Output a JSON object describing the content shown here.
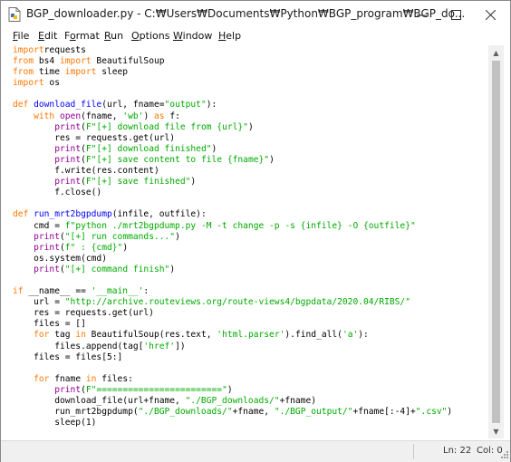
{
  "window": {
    "title": "BGP_downloader.py - C:₩Users₩Documents₩Python₩BGP_program₩BGP_do...",
    "app_icon": "python-file-icon",
    "minimize_icon": "minimize-icon",
    "maximize_icon": "maximize-icon",
    "close_icon": "close-icon"
  },
  "menu": [
    {
      "accel": "F",
      "rest": "ile"
    },
    {
      "accel": "E",
      "rest": "dit"
    },
    {
      "accel": "",
      "pre": "F",
      "accel2": "o",
      "rest": "rmat"
    },
    {
      "accel": "R",
      "rest": "un"
    },
    {
      "accel": "O",
      "rest": "ptions"
    },
    {
      "accel": "W",
      "rest": "indow"
    },
    {
      "accel": "H",
      "rest": "elp"
    }
  ],
  "menu_labels": [
    "File",
    "Edit",
    "Format",
    "Run",
    "Options",
    "Window",
    "Help"
  ],
  "editor": {
    "lines": [
      [
        [
          "kw",
          "import"
        ],
        [
          "",
          "requests"
        ]
      ],
      [
        [
          "kw",
          "from"
        ],
        [
          "",
          " bs4 "
        ],
        [
          "kw",
          "import"
        ],
        [
          "",
          " BeautifulSoup"
        ]
      ],
      [
        [
          "kw",
          "from"
        ],
        [
          "",
          " time "
        ],
        [
          "kw",
          "import"
        ],
        [
          "",
          " sleep"
        ]
      ],
      [
        [
          "kw",
          "import"
        ],
        [
          "",
          " os"
        ]
      ],
      [
        [
          "",
          ""
        ]
      ],
      [
        [
          "kw",
          "def"
        ],
        [
          "",
          " "
        ],
        [
          "df",
          "download_file"
        ],
        [
          "",
          "(url, fname="
        ],
        [
          "st",
          "\"output\""
        ],
        [
          "",
          "):"
        ]
      ],
      [
        [
          "",
          "    "
        ],
        [
          "kw",
          "with"
        ],
        [
          "",
          " "
        ],
        [
          "bi",
          "open"
        ],
        [
          "",
          "(fname, "
        ],
        [
          "st",
          "'wb'"
        ],
        [
          "",
          ") "
        ],
        [
          "kw",
          "as"
        ],
        [
          "",
          " f:"
        ]
      ],
      [
        [
          "",
          "        "
        ],
        [
          "bi",
          "print"
        ],
        [
          "",
          "("
        ],
        [
          "st",
          "F\"[+] download file from {url}\""
        ],
        [
          "",
          ")"
        ]
      ],
      [
        [
          "",
          "        res = requests.get(url)"
        ]
      ],
      [
        [
          "",
          "        "
        ],
        [
          "bi",
          "print"
        ],
        [
          "",
          "("
        ],
        [
          "st",
          "F\"[+] download finished\""
        ],
        [
          "",
          ")"
        ]
      ],
      [
        [
          "",
          "        "
        ],
        [
          "bi",
          "print"
        ],
        [
          "",
          "("
        ],
        [
          "st",
          "F\"[+] save content to file {fname}\""
        ],
        [
          "",
          ")"
        ]
      ],
      [
        [
          "",
          "        f.write(res.content)"
        ]
      ],
      [
        [
          "",
          "        "
        ],
        [
          "bi",
          "print"
        ],
        [
          "",
          "("
        ],
        [
          "st",
          "F\"[+] save finished\""
        ],
        [
          "",
          ")"
        ]
      ],
      [
        [
          "",
          "        f.close()"
        ]
      ],
      [
        [
          "",
          ""
        ]
      ],
      [
        [
          "kw",
          "def"
        ],
        [
          "",
          " "
        ],
        [
          "df",
          "run_mrt2bgpdump"
        ],
        [
          "",
          "(infile, outfile):"
        ]
      ],
      [
        [
          "",
          "    cmd = "
        ],
        [
          "st",
          "f\"python ./mrt2bgpdump.py -M -t change -p -s {infile} -O {outfile}\""
        ]
      ],
      [
        [
          "",
          "    "
        ],
        [
          "bi",
          "print"
        ],
        [
          "",
          "("
        ],
        [
          "st",
          "\"[+] run commands...\""
        ],
        [
          "",
          ")"
        ]
      ],
      [
        [
          "",
          "    "
        ],
        [
          "bi",
          "print"
        ],
        [
          "",
          "("
        ],
        [
          "st",
          "f\" : {cmd}\""
        ],
        [
          "",
          ")"
        ]
      ],
      [
        [
          "",
          "    os.system(cmd)"
        ]
      ],
      [
        [
          "",
          "    "
        ],
        [
          "bi",
          "print"
        ],
        [
          "",
          "("
        ],
        [
          "st",
          "\"[+] command finish\""
        ],
        [
          "",
          ")"
        ]
      ],
      [
        [
          "",
          ""
        ]
      ],
      [
        [
          "kw",
          "if"
        ],
        [
          "",
          " __name__ == "
        ],
        [
          "st",
          "'__main__'"
        ],
        [
          "",
          ":"
        ]
      ],
      [
        [
          "",
          "    url = "
        ],
        [
          "st",
          "\"http://archive.routeviews.org/route-views4/bgpdata/2020.04/RIBS/\""
        ]
      ],
      [
        [
          "",
          "    res = requests.get(url)"
        ]
      ],
      [
        [
          "",
          "    files = []"
        ]
      ],
      [
        [
          "",
          "    "
        ],
        [
          "kw",
          "for"
        ],
        [
          "",
          " tag "
        ],
        [
          "kw",
          "in"
        ],
        [
          "",
          " BeautifulSoup(res.text, "
        ],
        [
          "st",
          "'html.parser'"
        ],
        [
          "",
          ").find_all("
        ],
        [
          "st",
          "'a'"
        ],
        [
          "",
          "):"
        ]
      ],
      [
        [
          "",
          "        files.append(tag["
        ],
        [
          "st",
          "'href'"
        ],
        [
          "",
          "])"
        ]
      ],
      [
        [
          "",
          "    files = files[5:]"
        ]
      ],
      [
        [
          "",
          ""
        ]
      ],
      [
        [
          "",
          "    "
        ],
        [
          "kw",
          "for"
        ],
        [
          "",
          " fname "
        ],
        [
          "kw",
          "in"
        ],
        [
          "",
          " files:"
        ]
      ],
      [
        [
          "",
          "        "
        ],
        [
          "bi",
          "print"
        ],
        [
          "",
          "("
        ],
        [
          "st",
          "F\"========================\""
        ],
        [
          "",
          ")"
        ]
      ],
      [
        [
          "",
          "        download_file(url+fname, "
        ],
        [
          "st",
          "\"./BGP_downloads/\""
        ],
        [
          "",
          "+fname)"
        ]
      ],
      [
        [
          "",
          "        run_mrt2bgpdump("
        ],
        [
          "st",
          "\"./BGP_downloads/\""
        ],
        [
          "",
          "+fname, "
        ],
        [
          "st",
          "\"./BGP_output/\""
        ],
        [
          "",
          "+fname[:-4]+"
        ],
        [
          "st",
          "\".csv\""
        ],
        [
          "",
          ")"
        ]
      ],
      [
        [
          "",
          "        sleep(1)"
        ]
      ]
    ]
  },
  "status": {
    "line": "Ln: 22",
    "col": "Col: 0"
  },
  "colors": {
    "keyword": "#ff7700",
    "builtin": "#900090",
    "string": "#00aa00",
    "definition": "#0000ff"
  }
}
